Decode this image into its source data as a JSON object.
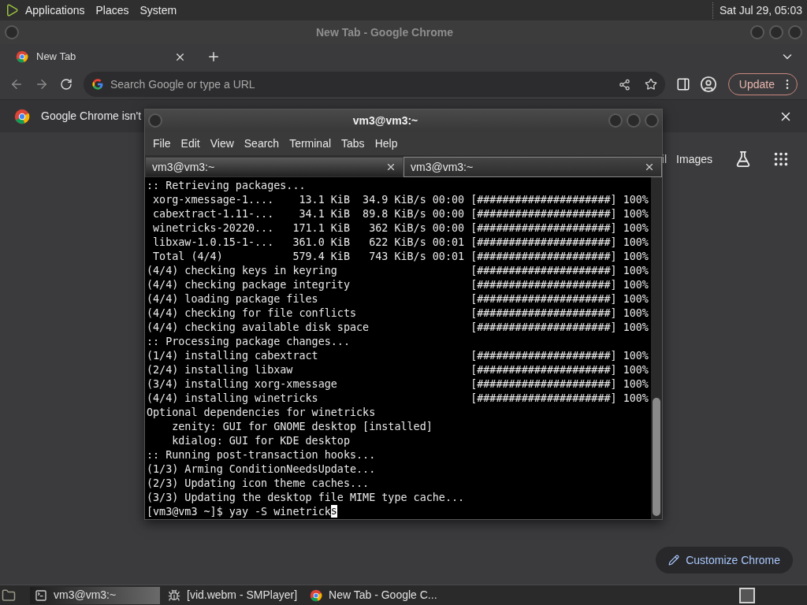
{
  "system_bar": {
    "menus": [
      "Applications",
      "Places",
      "System"
    ],
    "clock": "Sat Jul 29, 05:03"
  },
  "chrome": {
    "title": "New Tab - Google Chrome",
    "tabs": [
      {
        "label": "New Tab",
        "selected": true
      }
    ],
    "omnibox": {
      "placeholder": "Search Google or type a URL"
    },
    "update_button": "Update",
    "infobar": {
      "message": "Google Chrome isn't"
    },
    "links": [
      "il",
      "Images"
    ],
    "customize_button": "Customize Chrome"
  },
  "terminal": {
    "title": "vm3@vm3:~",
    "menus": [
      "File",
      "Edit",
      "View",
      "Search",
      "Terminal",
      "Tabs",
      "Help"
    ],
    "tabs": [
      {
        "label": "vm3@vm3:~",
        "selected": false
      },
      {
        "label": "vm3@vm3:~",
        "selected": true
      }
    ],
    "lines": [
      {
        "kind": "plain",
        "text": ":: Retrieving packages..."
      },
      {
        "kind": "progress",
        "text": " xorg-xmessage-1....    13.1 KiB  34.9 KiB/s 00:00",
        "bar": "[#####################]",
        "percent": "100%"
      },
      {
        "kind": "progress",
        "text": " cabextract-1.11-...    34.1 KiB  89.8 KiB/s 00:00",
        "bar": "[#####################]",
        "percent": "100%"
      },
      {
        "kind": "progress",
        "text": " winetricks-20220...   171.1 KiB   362 KiB/s 00:00",
        "bar": "[#####################]",
        "percent": "100%"
      },
      {
        "kind": "progress",
        "text": " libxaw-1.0.15-1-...   361.0 KiB   622 KiB/s 00:01",
        "bar": "[#####################]",
        "percent": "100%"
      },
      {
        "kind": "progress",
        "text": " Total (4/4)           579.4 KiB   743 KiB/s 00:01",
        "bar": "[#####################]",
        "percent": "100%"
      },
      {
        "kind": "progress",
        "text": "(4/4) checking keys in keyring",
        "bar": "[#####################]",
        "percent": "100%"
      },
      {
        "kind": "progress",
        "text": "(4/4) checking package integrity",
        "bar": "[#####################]",
        "percent": "100%"
      },
      {
        "kind": "progress",
        "text": "(4/4) loading package files",
        "bar": "[#####################]",
        "percent": "100%"
      },
      {
        "kind": "progress",
        "text": "(4/4) checking for file conflicts",
        "bar": "[#####################]",
        "percent": "100%"
      },
      {
        "kind": "progress",
        "text": "(4/4) checking available disk space",
        "bar": "[#####################]",
        "percent": "100%"
      },
      {
        "kind": "plain",
        "text": ":: Processing package changes..."
      },
      {
        "kind": "progress",
        "text": "(1/4) installing cabextract",
        "bar": "[#####################]",
        "percent": "100%"
      },
      {
        "kind": "progress",
        "text": "(2/4) installing libxaw",
        "bar": "[#####################]",
        "percent": "100%"
      },
      {
        "kind": "progress",
        "text": "(3/4) installing xorg-xmessage",
        "bar": "[#####################]",
        "percent": "100%"
      },
      {
        "kind": "progress",
        "text": "(4/4) installing winetricks",
        "bar": "[#####################]",
        "percent": "100%"
      },
      {
        "kind": "plain",
        "text": "Optional dependencies for winetricks"
      },
      {
        "kind": "plain",
        "text": "    zenity: GUI for GNOME desktop [installed]"
      },
      {
        "kind": "plain",
        "text": "    kdialog: GUI for KDE desktop"
      },
      {
        "kind": "plain",
        "text": ":: Running post-transaction hooks..."
      },
      {
        "kind": "plain",
        "text": "(1/3) Arming ConditionNeedsUpdate..."
      },
      {
        "kind": "plain",
        "text": "(2/3) Updating icon theme caches..."
      },
      {
        "kind": "plain",
        "text": "(3/3) Updating the desktop file MIME type cache..."
      }
    ],
    "prompt": "[vm3@vm3 ~]$ yay -S winetrick",
    "cursor_char": "s"
  },
  "taskbar": {
    "items": [
      {
        "kind": "terminal",
        "label": "vm3@vm3:~",
        "selected": true
      },
      {
        "kind": "player",
        "label": "[vid.webm - SMPlayer]",
        "selected": false
      },
      {
        "kind": "browser",
        "label": "New Tab - Google C...",
        "selected": false
      }
    ]
  }
}
